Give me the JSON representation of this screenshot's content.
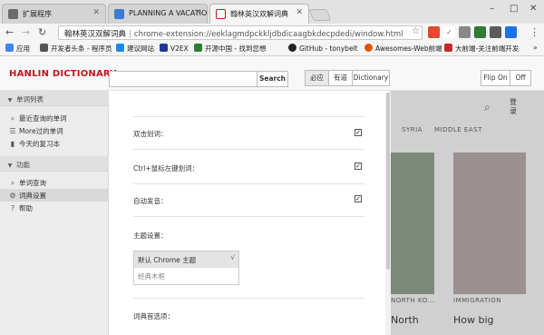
{
  "browser": {
    "tabs": [
      {
        "label": "扩展程序"
      },
      {
        "label": "PLANNING A VACATIO"
      },
      {
        "label": "翰林英汉双解词典"
      }
    ],
    "window_controls": {
      "min": "–",
      "max": "□",
      "close": "✕"
    },
    "address": {
      "host": "翰林英汉双解词典",
      "url": "chrome-extension://eeklagmdpckkljdbdicaagbkdecpdedi/window.html"
    },
    "bookmarks": [
      {
        "label": "应用"
      },
      {
        "label": "开发者头条 - 程序员"
      },
      {
        "label": "建议网站"
      },
      {
        "label": "V2EX"
      },
      {
        "label": "开源中国 - 找到您想"
      },
      {
        "label": "GitHub - tonybelt"
      },
      {
        "label": "Awesomes-Web前端"
      },
      {
        "label": "大前端-关注前端开发"
      }
    ],
    "more_bookmarks": "»"
  },
  "app": {
    "logo": "HANLIN DICTIONARY",
    "search_button": "Search",
    "sources": [
      "必应",
      "有道",
      "Dictionary"
    ],
    "flip": [
      "Flip On",
      "Off"
    ]
  },
  "sidebar": {
    "section1": "单词列表",
    "items1": [
      "最近查询的单词",
      "More过的单词",
      "今天的复习本"
    ],
    "section2": "功能",
    "items2": [
      "单词查询",
      "词典设置",
      "帮助"
    ]
  },
  "settings": {
    "rows": [
      {
        "label": "双击划词："
      },
      {
        "label": "Ctrl+鼠标左键划词："
      },
      {
        "label": "自动发音："
      }
    ],
    "theme_label": "主题设置：",
    "theme_options": [
      "默认 Chrome 主题",
      "经典木框"
    ],
    "check_mark": "√",
    "dict_pref_label": "词典首选项："
  },
  "background_page": {
    "tags": [
      "SYRIA",
      "MIDDLE EAST"
    ],
    "login": "登录",
    "caption1": "NORTH KO...",
    "caption2": "IMMIGRATION",
    "headline1": "North",
    "headline2": "How big"
  }
}
